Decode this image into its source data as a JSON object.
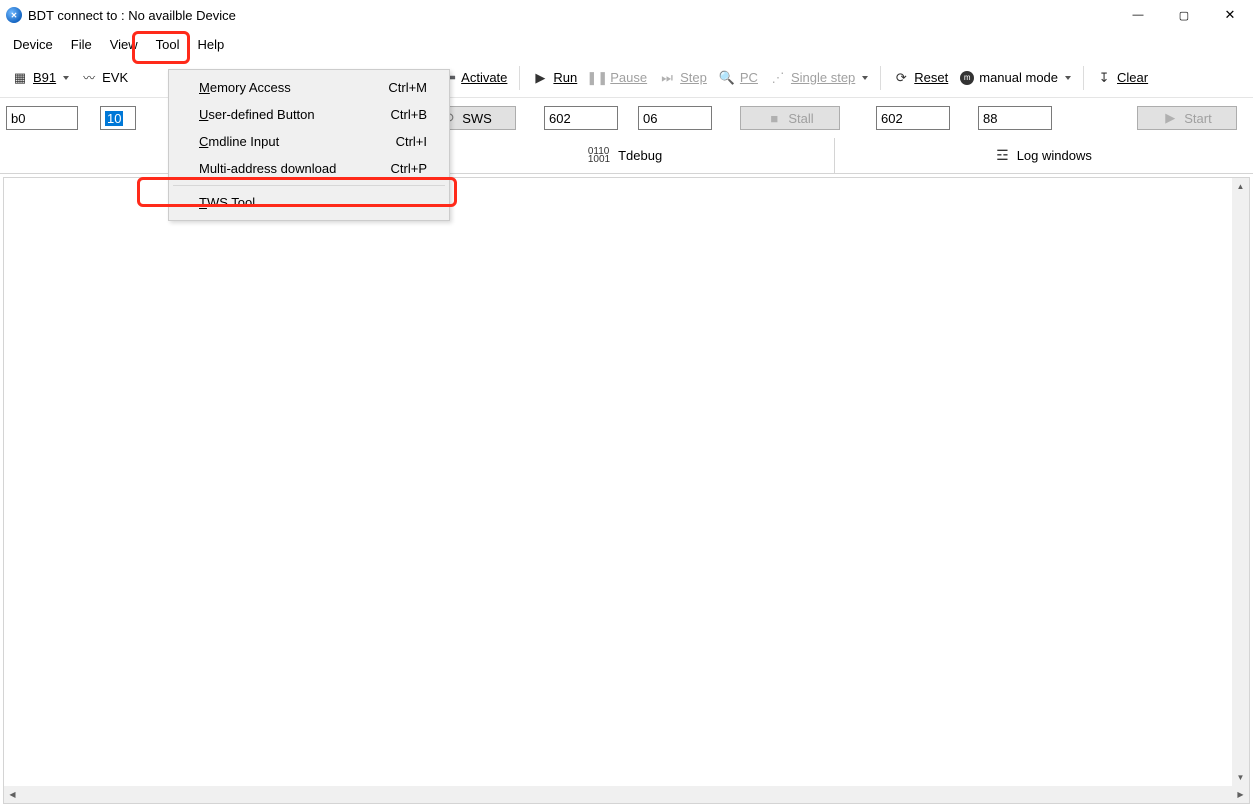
{
  "window": {
    "title": "BDT connect to : No availble Device",
    "controls": {
      "min": "—",
      "max": "▢",
      "close": "✕"
    }
  },
  "menu": {
    "items": [
      "Device",
      "File",
      "View",
      "Tool",
      "Help"
    ]
  },
  "tool_dropdown": {
    "items": [
      {
        "label": "Memory Access",
        "u": "M",
        "shortcut": "Ctrl+M"
      },
      {
        "label": "User-defined Button",
        "u": "U",
        "shortcut": "Ctrl+B"
      },
      {
        "label": "Cmdline Input",
        "u": "C",
        "shortcut": "Ctrl+I"
      },
      {
        "label": "Multi-address download",
        "u": "",
        "shortcut": "Ctrl+P"
      },
      {
        "label": "TWS Tool",
        "u": "T",
        "shortcut": ""
      }
    ]
  },
  "toolbar1": {
    "chip": "B91",
    "evk": "EVK",
    "activate": "Activate",
    "run": "Run",
    "pause": "Pause",
    "step": "Step",
    "pc": "PC",
    "single_step": "Single step",
    "reset": "Reset",
    "manual_mode": "manual mode",
    "clear": "Clear"
  },
  "toolbar2": {
    "input_left1": "b0",
    "input_left2": "10",
    "sws_btn": "SWS",
    "in_a": "602",
    "in_b": "06",
    "stall_btn": "Stall",
    "in_c": "602",
    "in_d": "88",
    "start_btn": "Start"
  },
  "tabs": {
    "tdebug": "Tdebug",
    "logwin": "Log windows"
  }
}
